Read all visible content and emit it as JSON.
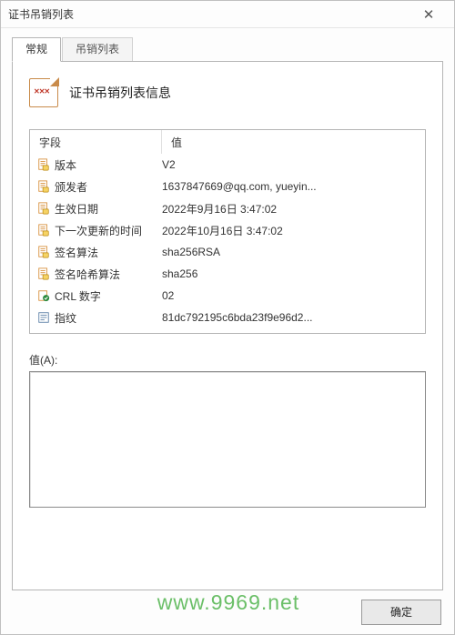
{
  "window": {
    "title": "证书吊销列表"
  },
  "tabs": {
    "general": "常规",
    "crl_list": "吊销列表"
  },
  "heading": "证书吊销列表信息",
  "table": {
    "header_field": "字段",
    "header_value": "值",
    "rows": [
      {
        "icon": "doc",
        "field": "版本",
        "value": "V2"
      },
      {
        "icon": "doc",
        "field": "颁发者",
        "value": "1637847669@qq.com, yueyin..."
      },
      {
        "icon": "doc",
        "field": "生效日期",
        "value": "2022年9月16日 3:47:02"
      },
      {
        "icon": "doc",
        "field": "下一次更新的时间",
        "value": "2022年10月16日 3:47:02"
      },
      {
        "icon": "doc",
        "field": "签名算法",
        "value": "sha256RSA"
      },
      {
        "icon": "doc",
        "field": "签名哈希算法",
        "value": "sha256"
      },
      {
        "icon": "ext",
        "field": "CRL 数字",
        "value": "02"
      },
      {
        "icon": "prop",
        "field": "指纹",
        "value": "81dc792195c6bda23f9e96d2..."
      }
    ]
  },
  "value_section": {
    "label": "值(A):"
  },
  "buttons": {
    "ok": "确定"
  },
  "watermark": "www.9969.net",
  "colors": {
    "icon_doc": "#d8903c",
    "icon_ext": "#2b8a3e",
    "icon_prop": "#5b7fa6"
  }
}
